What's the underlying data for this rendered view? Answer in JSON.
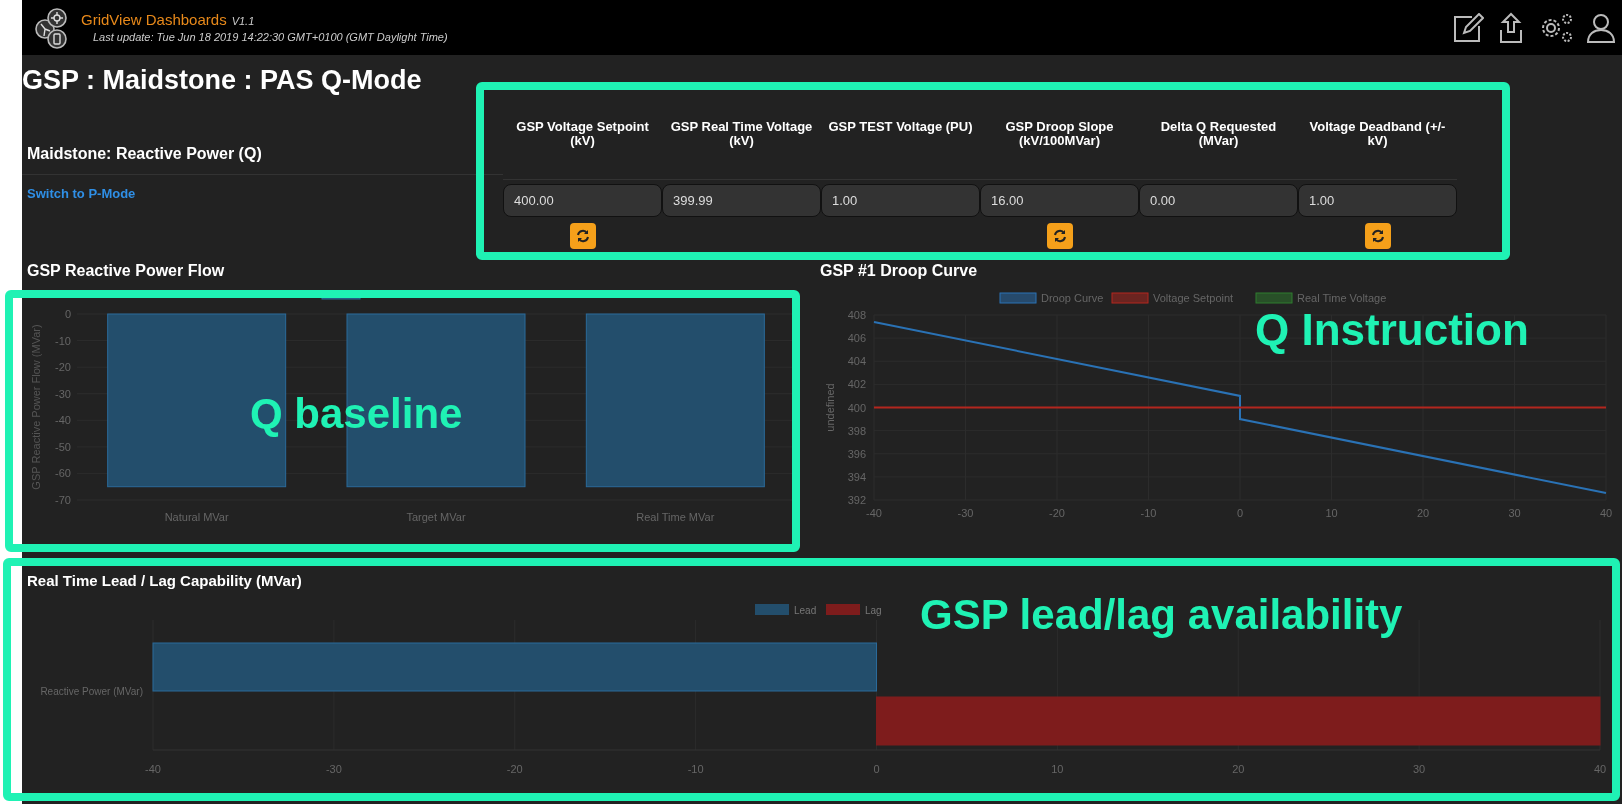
{
  "header": {
    "app_name": "GridView Dashboards",
    "version": "V1.1",
    "last_update": "Last update: Tue Jun 18 2019 14:22:30 GMT+0100 (GMT Daylight Time)"
  },
  "page_title": "GSP : Maidstone : PAS Q-Mode",
  "section_title": "Maidstone: Reactive Power (Q)",
  "mode_link": "Switch to P-Mode",
  "fields": [
    {
      "label": "GSP Voltage Setpoint (kV)",
      "value": "400.00",
      "refresh": true
    },
    {
      "label": "GSP Real Time Voltage (kV)",
      "value": "399.99",
      "refresh": false
    },
    {
      "label": "GSP TEST Voltage (PU)",
      "value": "1.00",
      "refresh": false
    },
    {
      "label": "GSP Droop Slope (kV/100MVar)",
      "value": "16.00",
      "refresh": true
    },
    {
      "label": "Delta Q Requested (MVar)",
      "value": "0.00",
      "refresh": false
    },
    {
      "label": "Voltage Deadband (+/- kV)",
      "value": "1.00",
      "refresh": true
    }
  ],
  "flow_panel": {
    "title": "GSP Reactive Power Flow",
    "chart_data": {
      "type": "bar",
      "ylabel": "GSP Reactive Power Flow (MVar)",
      "categories": [
        "Natural MVar",
        "Target MVar",
        "Real Time MVar"
      ],
      "series": [
        {
          "color": "#234e6c",
          "values": [
            -65,
            -65,
            -65
          ]
        }
      ],
      "ylim": [
        -70,
        0
      ],
      "yticks": [
        0,
        -10,
        -20,
        -30,
        -40,
        -50,
        -60,
        -70
      ],
      "grid": true
    }
  },
  "droop_panel": {
    "title": "GSP #1 Droop Curve",
    "chart_data": {
      "type": "line",
      "ylabel": "undefined",
      "x": [
        -40,
        0,
        0,
        40
      ],
      "series": [
        {
          "name": "Droop Curve",
          "color": "#2a72b5",
          "values": [
            407.4,
            401,
            399,
            392.6
          ]
        },
        {
          "name": "Voltage Setpoint",
          "color": "#b3261e",
          "values": [
            400,
            400,
            400,
            400
          ]
        },
        {
          "name": "Real Time Voltage",
          "color": "#2e7d2e",
          "values": [
            null,
            null,
            null,
            null
          ]
        }
      ],
      "xlim": [
        -40,
        40
      ],
      "ylim": [
        392,
        408
      ],
      "xticks": [
        -40,
        -30,
        -20,
        -10,
        0,
        10,
        20,
        30,
        40
      ],
      "yticks": [
        392,
        394,
        396,
        398,
        400,
        402,
        404,
        406,
        408
      ],
      "grid": true,
      "legend": true
    }
  },
  "capability_panel": {
    "title": "Real Time Lead / Lag Capability (MVar)",
    "chart_data": {
      "type": "bar",
      "orientation": "horizontal",
      "categories": [
        "Reactive Power (MVar)"
      ],
      "series": [
        {
          "name": "Lead",
          "color": "#234e6c",
          "values": [
            -40
          ]
        },
        {
          "name": "Lag",
          "color": "#7e1c1c",
          "values": [
            40
          ]
        }
      ],
      "xlim": [
        -40,
        40
      ],
      "xticks": [
        -40,
        -30,
        -20,
        -10,
        0,
        10,
        20,
        30,
        40
      ],
      "grid": true,
      "legend": true
    }
  },
  "annotation_labels": [
    "Q baseline",
    "Q Instruction",
    "GSP lead/lag availability"
  ]
}
